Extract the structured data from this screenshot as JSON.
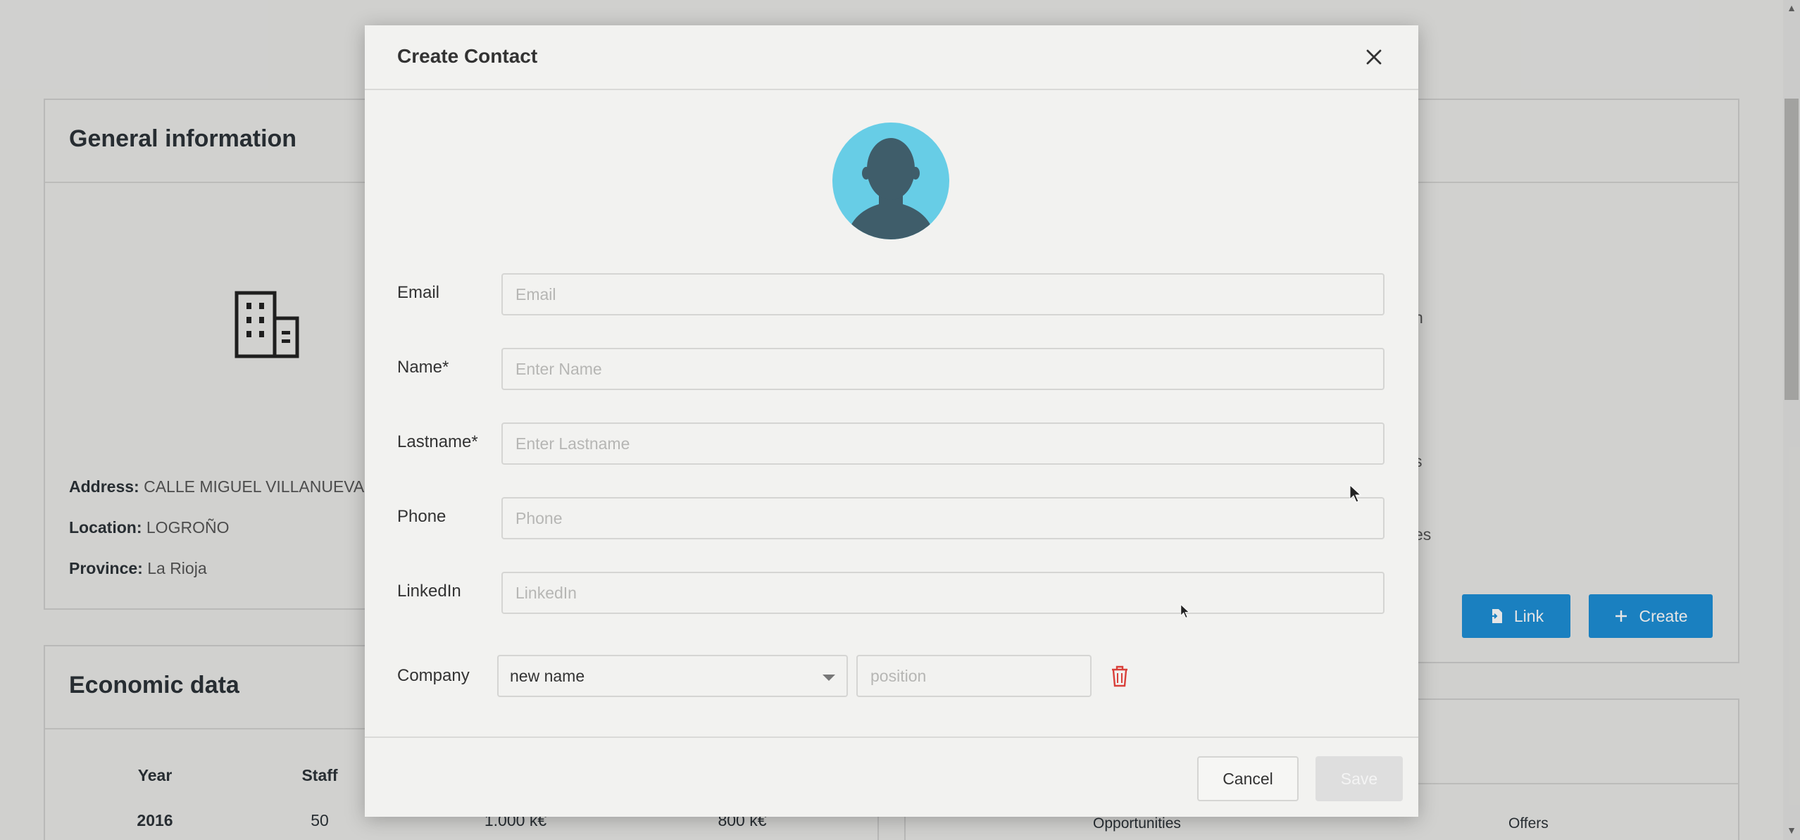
{
  "background": {
    "general_info": {
      "title": "General information",
      "address_label": "Address:",
      "address_value": "CALLE MIGUEL VILLANUEVA,",
      "location_label": "Location:",
      "location_value": "LOGROÑO",
      "province_label": "Province:",
      "province_value": "La Rioja"
    },
    "economic_data": {
      "title": "Economic data",
      "headers": [
        "Year",
        "Staff"
      ],
      "row": [
        "2016",
        "50",
        "1.000 k€",
        "800 k€"
      ]
    },
    "right_panel": {
      "partial_texts": [
        "n",
        "s",
        "es"
      ],
      "link_button": "Link",
      "create_button": "Create"
    },
    "bottom_tabs": [
      "Opportunities",
      "Offers"
    ]
  },
  "modal": {
    "title": "Create Contact",
    "fields": {
      "email": {
        "label": "Email",
        "placeholder": "Email",
        "value": ""
      },
      "name": {
        "label": "Name*",
        "placeholder": "Enter Name",
        "value": ""
      },
      "lastname": {
        "label": "Lastname*",
        "placeholder": "Enter Lastname",
        "value": ""
      },
      "phone": {
        "label": "Phone",
        "placeholder": "Phone",
        "value": ""
      },
      "linkedin": {
        "label": "LinkedIn",
        "placeholder": "LinkedIn",
        "value": ""
      }
    },
    "company": {
      "label": "Company",
      "selected": "new name",
      "position_placeholder": "position"
    },
    "cancel_label": "Cancel",
    "save_label": "Save"
  },
  "colors": {
    "accent_blue": "#1d8fd6",
    "avatar_bg": "#67cde6",
    "avatar_silhouette": "#3f5d6a",
    "delete_red": "#d9403a"
  }
}
